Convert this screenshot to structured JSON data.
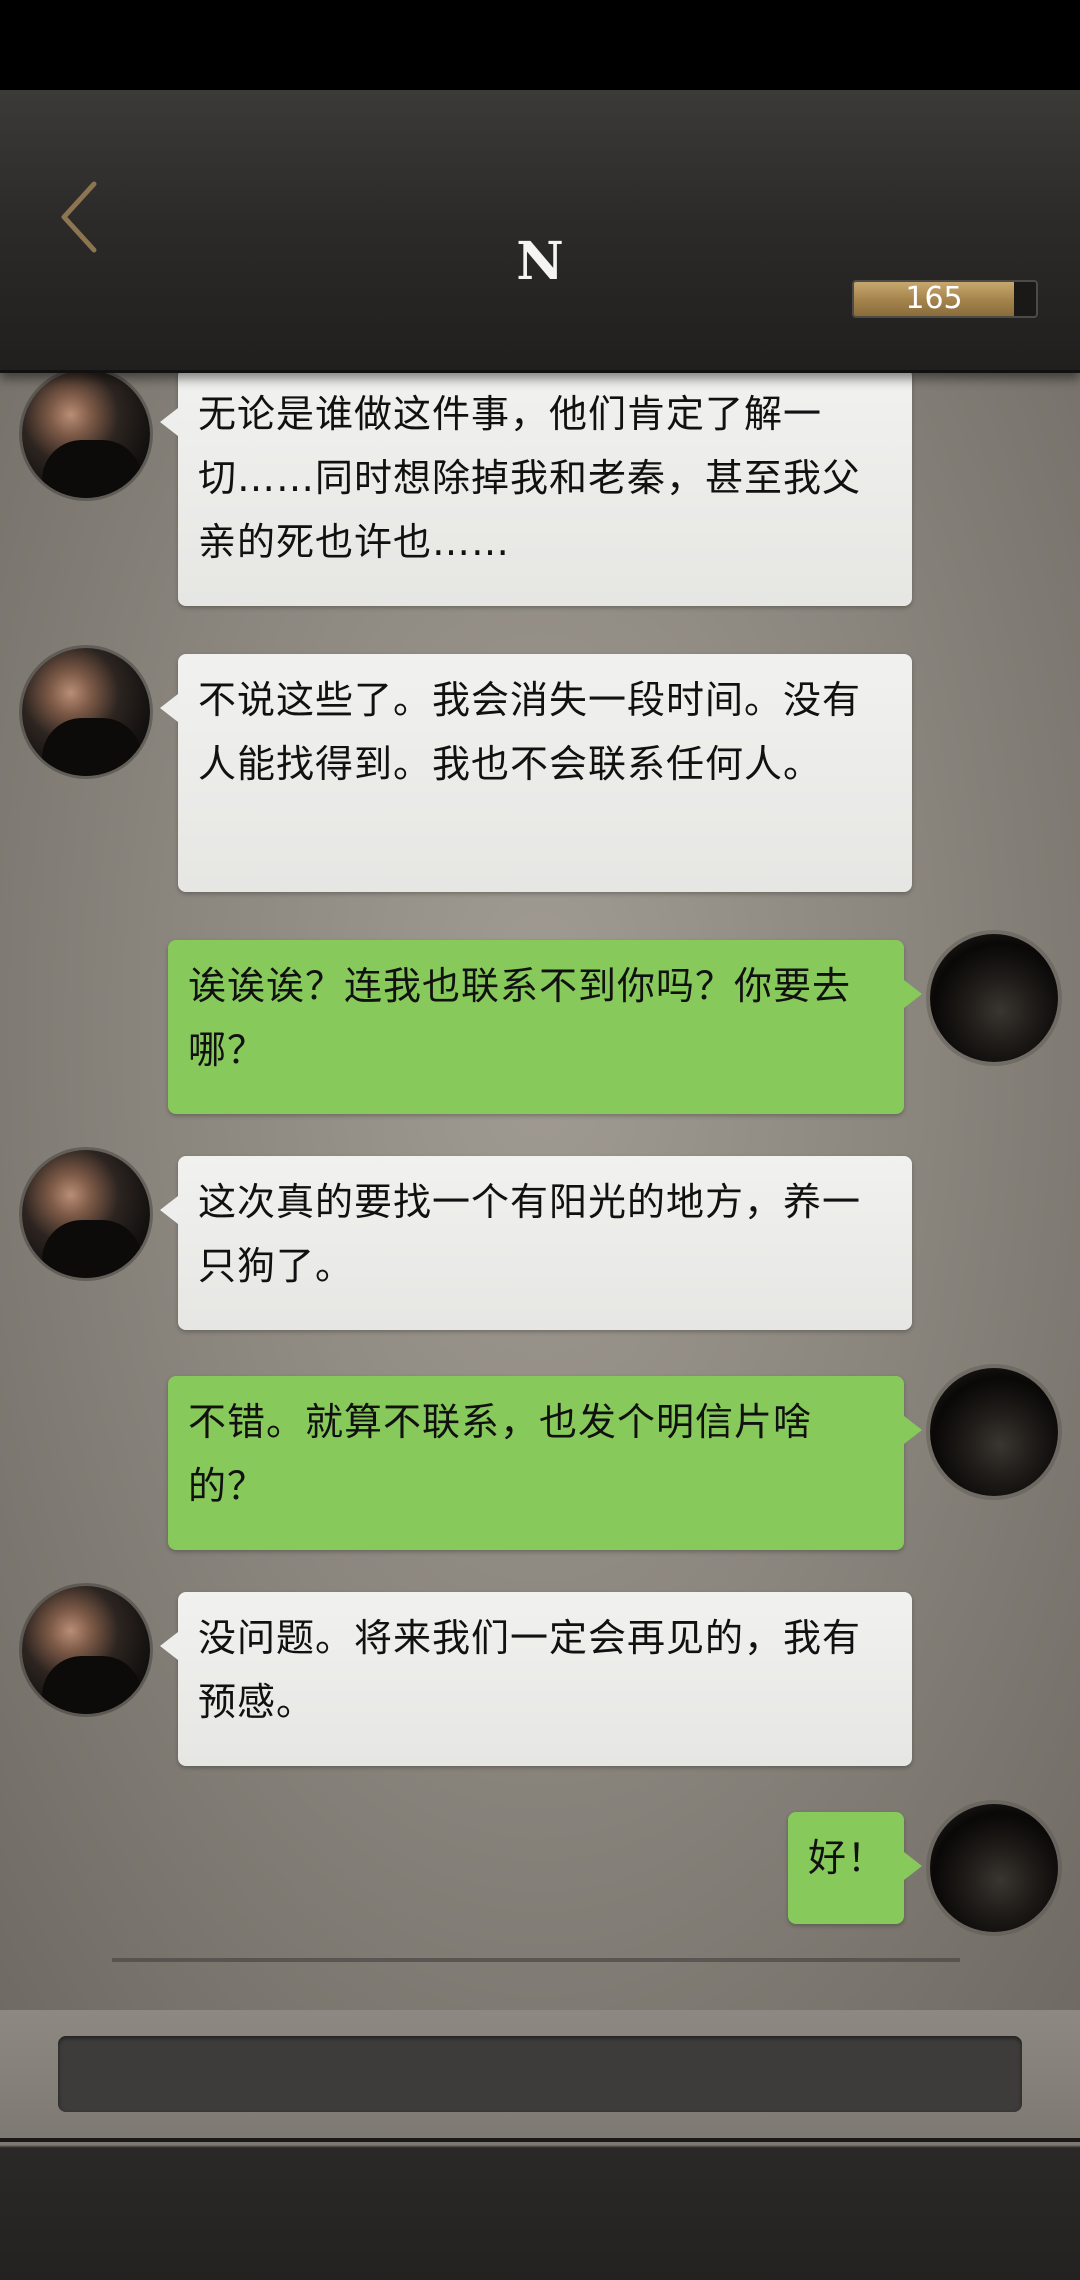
{
  "header": {
    "title": "N",
    "counter": {
      "value": "165",
      "fill_fraction": 0.88
    }
  },
  "messages": [
    {
      "side": "other",
      "text": "无论是谁做这件事，他们肯定了解一切……同时想除掉我和老秦，甚至我父亲的死也许也……"
    },
    {
      "side": "other",
      "text": "不说这些了。我会消失一段时间。没有人能找得到。我也不会联系任何人。"
    },
    {
      "side": "self",
      "text": "诶诶诶？连我也联系不到你吗？你要去哪？"
    },
    {
      "side": "other",
      "text": "这次真的要找一个有阳光的地方，养一只狗了。"
    },
    {
      "side": "self",
      "text": "不错。就算不联系，也发个明信片啥的？"
    },
    {
      "side": "other",
      "text": "没问题。将来我们一定会再见的，我有预感。"
    },
    {
      "side": "self",
      "text": "好！"
    }
  ],
  "colors": {
    "self_bubble": "#87c95a",
    "other_bubble": "#eeeeec",
    "counter_fill": "#a4824b"
  },
  "icons": {
    "back": "chevron-left-icon"
  }
}
